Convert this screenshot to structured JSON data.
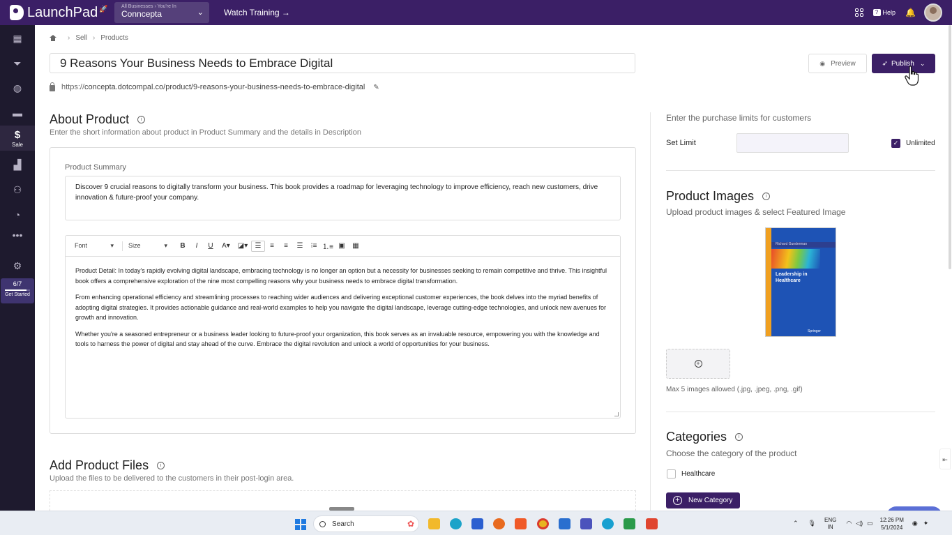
{
  "topbar": {
    "app_name": "LaunchPad",
    "business_breadcrumb": "All Businesses › You're In",
    "business_name": "Conncepta",
    "watch_training": "Watch Training →",
    "help_label": "Help"
  },
  "sidebar": {
    "active_label": "Sale",
    "progress_value": "6/7",
    "progress_fraction": 0.857,
    "progress_label": "Get Started"
  },
  "breadcrumb": {
    "items": [
      "Sell",
      "Products"
    ]
  },
  "product": {
    "title": "9 Reasons Your Business Needs to Embrace Digital",
    "url_prefix": "https://",
    "url_rest": "concepta.dotcompal.co/product/9-reasons-your-business-needs-to-embrace-digital"
  },
  "actions": {
    "preview_label": "Preview",
    "publish_label": "Publish"
  },
  "about": {
    "title": "About Product",
    "subtitle": "Enter the short information about product in Product Summary and the details in Description",
    "summary_label": "Product Summary",
    "summary_text": "Discover 9 crucial reasons to digitally transform your business. This book provides a roadmap for leveraging technology to improve efficiency, reach new customers, drive innovation & future-proof your company.",
    "toolbar": {
      "font_label": "Font",
      "size_label": "Size"
    },
    "description": [
      "Product Detail: In today's rapidly evolving digital landscape, embracing technology is no longer an option but a necessity for businesses seeking to remain competitive and thrive. This insightful book offers a comprehensive exploration of the nine most compelling reasons why your business needs to embrace digital transformation.",
      "From enhancing operational efficiency and streamlining processes to reaching wider audiences and delivering exceptional customer experiences, the book delves into the myriad benefits of adopting digital strategies. It provides actionable guidance and real-world examples to help you navigate the digital landscape, leverage cutting-edge technologies, and unlock new avenues for growth and innovation.",
      "Whether you're a seasoned entrepreneur or a business leader looking to future-proof your organization, this book serves as an invaluable resource, empowering you with the knowledge and tools to harness the power of digital and stay ahead of the curve. Embrace the digital revolution and unlock a world of opportunities for your business."
    ]
  },
  "files": {
    "title": "Add Product Files",
    "subtitle": "Upload the files to be delivered to the customers in their post-login area."
  },
  "limits": {
    "heading": "Enter the purchase limits for customers",
    "set_limit_label": "Set Limit",
    "limit_value": "",
    "unlimited_label": "Unlimited",
    "unlimited_checked": true
  },
  "images": {
    "title": "Product Images",
    "subtitle": "Upload product images & select Featured Image",
    "book_author": "Richard Gunderman",
    "book_title_1": "Leadership in",
    "book_title_2": "Healthcare",
    "book_publisher": "Springer",
    "limit_note": "Max 5 images allowed (.jpg, .jpeg, .png, .gif)"
  },
  "categories": {
    "title": "Categories",
    "subtitle": "Choose the category of the product",
    "items": [
      {
        "label": "Healthcare",
        "checked": false
      }
    ],
    "new_category_label": "New Category"
  },
  "taskbar": {
    "search_placeholder": "Search",
    "lang_1": "ENG",
    "lang_2": "IN",
    "time": "12:26 PM",
    "date": "5/1/2024"
  },
  "colors": {
    "brand": "#3b1f66",
    "sidebar": "#1e1a2e"
  }
}
